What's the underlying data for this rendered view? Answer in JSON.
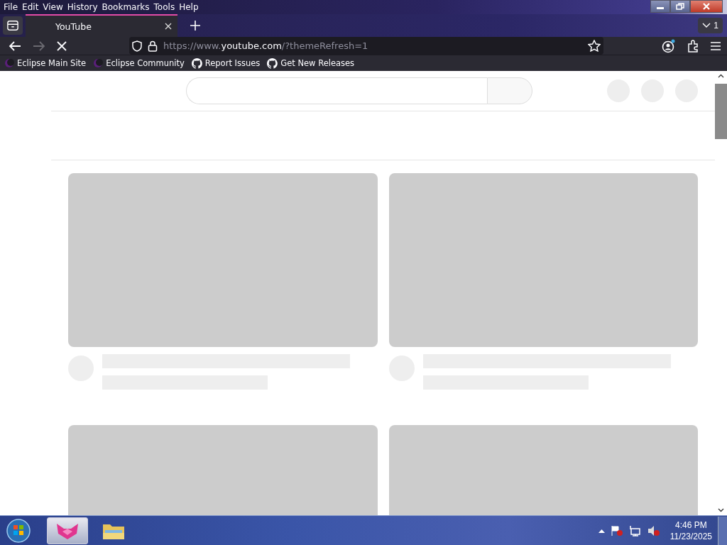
{
  "menu_bar": [
    "File",
    "Edit",
    "View",
    "History",
    "Bookmarks",
    "Tools",
    "Help"
  ],
  "tabs": [
    {
      "title": "YouTube",
      "selected": true
    }
  ],
  "tab_count": "1",
  "nav": {
    "forward_disabled": true,
    "loading": true,
    "url_prefix": "https://www.",
    "url_host": "youtube.com",
    "url_suffix": "/?themeRefresh=1"
  },
  "bookmarks": [
    {
      "label": "Eclipse Main Site",
      "kind": "eclipse"
    },
    {
      "label": "Eclipse Community",
      "kind": "eclipse"
    },
    {
      "label": "Report Issues",
      "kind": "github"
    },
    {
      "label": "Get New Releases",
      "kind": "github"
    }
  ],
  "feed": [
    {
      "kind": "loading"
    },
    {
      "kind": "loading"
    },
    {
      "kind": "thumbnail"
    },
    {
      "kind": "thumbnail"
    }
  ],
  "taskbar": {
    "time": "4:46 PM",
    "date": "11/23/2025"
  }
}
